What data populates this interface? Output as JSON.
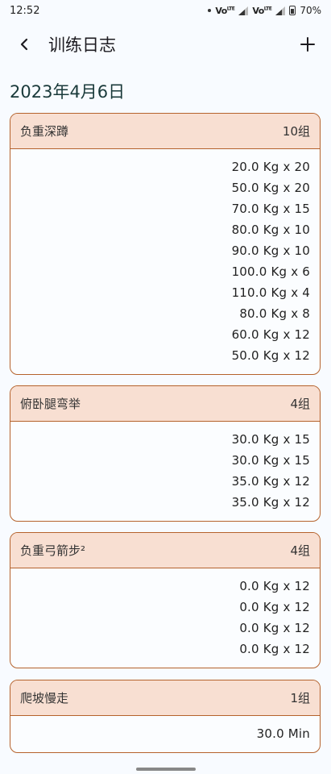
{
  "status": {
    "time": "12:52",
    "battery": "70%",
    "volte": "Vo",
    "network": "LTE"
  },
  "app_bar": {
    "title": "训练日志",
    "back_icon": "chevron-left-icon",
    "add_icon": "plus-icon"
  },
  "date": "2023年4月6日",
  "exercises": [
    {
      "name": "负重深蹲",
      "count": "10组",
      "sets": [
        "20.0 Kg x 20",
        "50.0 Kg x 20",
        "70.0 Kg x 15",
        "80.0 Kg x 10",
        "90.0 Kg x 10",
        "100.0 Kg x 6",
        "110.0 Kg x 4",
        "80.0 Kg x 8",
        "60.0 Kg x 12",
        "50.0 Kg x 12"
      ]
    },
    {
      "name": "俯卧腿弯举",
      "count": "4组",
      "sets": [
        "30.0 Kg x 15",
        "30.0 Kg x 15",
        "35.0 Kg x 12",
        "35.0 Kg x 12"
      ]
    },
    {
      "name": "负重弓箭步²",
      "count": "4组",
      "sets": [
        "0.0 Kg x 12",
        "0.0 Kg x 12",
        "0.0 Kg x 12",
        "0.0 Kg x 12"
      ]
    },
    {
      "name": "爬坡慢走",
      "count": "1组",
      "sets": [
        "30.0 Min"
      ]
    }
  ],
  "colors": {
    "card_border": "#b5622c",
    "card_header_bg": "#f8dfd2",
    "page_bg": "#f8fbff"
  }
}
